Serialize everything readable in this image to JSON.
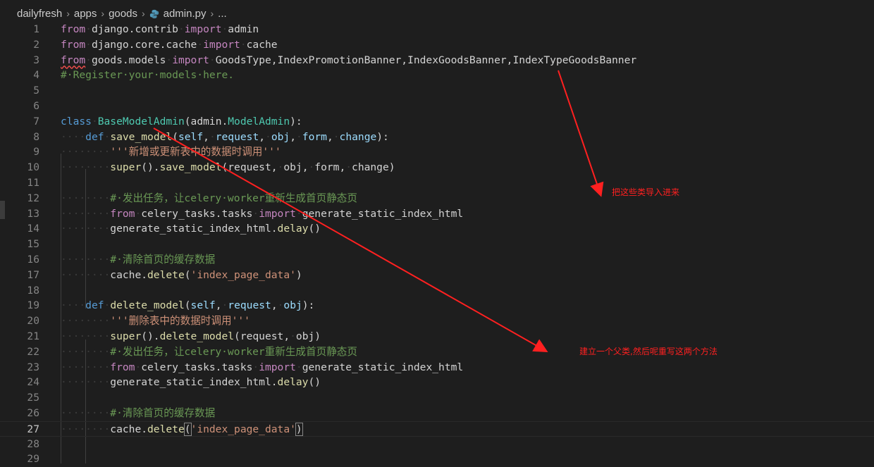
{
  "breadcrumb": {
    "items": [
      "dailyfresh",
      "apps",
      "goods",
      "admin.py",
      "..."
    ]
  },
  "lines": [
    {
      "n": "1",
      "tokens": [
        [
          "kw2",
          "from"
        ],
        [
          "ws",
          "·"
        ],
        [
          "",
          "django.contrib"
        ],
        [
          "ws",
          "·"
        ],
        [
          "kw2",
          "import"
        ],
        [
          "ws",
          "·"
        ],
        [
          "",
          "admin"
        ]
      ]
    },
    {
      "n": "2",
      "tokens": [
        [
          "kw2",
          "from"
        ],
        [
          "ws",
          "·"
        ],
        [
          "",
          "django.core.cache"
        ],
        [
          "ws",
          "·"
        ],
        [
          "kw2",
          "import"
        ],
        [
          "ws",
          "·"
        ],
        [
          "",
          "cache"
        ]
      ]
    },
    {
      "n": "3",
      "tokens": [
        [
          "kw2 squig",
          "from"
        ],
        [
          "ws",
          "·"
        ],
        [
          "",
          "goods.models"
        ],
        [
          "ws",
          "·"
        ],
        [
          "kw2",
          "import"
        ],
        [
          "ws",
          "·"
        ],
        [
          "",
          "GoodsType,IndexPromotionBanner,IndexGoodsBanner,IndexTypeGoodsBanner"
        ]
      ]
    },
    {
      "n": "4",
      "tokens": [
        [
          "cmt",
          "#·Register·your·models·here."
        ]
      ]
    },
    {
      "n": "5",
      "tokens": []
    },
    {
      "n": "6",
      "tokens": []
    },
    {
      "n": "7",
      "tokens": [
        [
          "kw",
          "class"
        ],
        [
          "ws",
          "·"
        ],
        [
          "cls",
          "BaseModelAdmin"
        ],
        [
          "",
          "("
        ],
        [
          "",
          "admin."
        ],
        [
          "cls",
          "ModelAdmin"
        ],
        [
          "",
          "):"
        ]
      ]
    },
    {
      "n": "8",
      "tokens": [
        [
          "ws",
          "····"
        ],
        [
          "kw",
          "def"
        ],
        [
          "ws",
          "·"
        ],
        [
          "fn",
          "save_model"
        ],
        [
          "",
          "("
        ],
        [
          "var",
          "self"
        ],
        [
          "",
          ","
        ],
        [
          "ws",
          "·"
        ],
        [
          "var",
          "request"
        ],
        [
          "",
          ","
        ],
        [
          "ws",
          "·"
        ],
        [
          "var",
          "obj"
        ],
        [
          "",
          ","
        ],
        [
          "ws",
          "·"
        ],
        [
          "var",
          "form"
        ],
        [
          "",
          ","
        ],
        [
          "ws",
          "·"
        ],
        [
          "var",
          "change"
        ],
        [
          "",
          "):"
        ]
      ]
    },
    {
      "n": "9",
      "tokens": [
        [
          "ws",
          "········"
        ],
        [
          "str",
          "'''新增或更新表中的数据时调用'''"
        ]
      ]
    },
    {
      "n": "10",
      "tokens": [
        [
          "ws",
          "········"
        ],
        [
          "fn",
          "super"
        ],
        [
          "",
          "()."
        ],
        [
          "fn",
          "save_model"
        ],
        [
          "",
          "(request,"
        ],
        [
          "ws",
          "·"
        ],
        [
          "",
          "obj,"
        ],
        [
          "ws",
          "·"
        ],
        [
          "",
          "form,"
        ],
        [
          "ws",
          "·"
        ],
        [
          "",
          "change)"
        ]
      ]
    },
    {
      "n": "11",
      "tokens": []
    },
    {
      "n": "12",
      "tokens": [
        [
          "ws",
          "········"
        ],
        [
          "cmt",
          "#·发出任务，让celery·worker重新生成首页静态页"
        ]
      ]
    },
    {
      "n": "13",
      "tokens": [
        [
          "ws",
          "········"
        ],
        [
          "kw2",
          "from"
        ],
        [
          "ws",
          "·"
        ],
        [
          "",
          "celery_tasks.tasks"
        ],
        [
          "ws",
          "·"
        ],
        [
          "kw2",
          "import"
        ],
        [
          "ws",
          "·"
        ],
        [
          "",
          "generate_static_index_html"
        ]
      ]
    },
    {
      "n": "14",
      "tokens": [
        [
          "ws",
          "········"
        ],
        [
          "",
          "generate_static_index_html."
        ],
        [
          "fn",
          "delay"
        ],
        [
          "",
          "()"
        ]
      ]
    },
    {
      "n": "15",
      "tokens": []
    },
    {
      "n": "16",
      "tokens": [
        [
          "ws",
          "········"
        ],
        [
          "cmt",
          "#·清除首页的缓存数据"
        ]
      ]
    },
    {
      "n": "17",
      "tokens": [
        [
          "ws",
          "········"
        ],
        [
          "",
          "cache."
        ],
        [
          "fn",
          "delete"
        ],
        [
          "",
          "("
        ],
        [
          "str",
          "'index_page_data'"
        ],
        [
          "",
          ")"
        ]
      ]
    },
    {
      "n": "18",
      "tokens": []
    },
    {
      "n": "19",
      "tokens": [
        [
          "ws",
          "····"
        ],
        [
          "kw",
          "def"
        ],
        [
          "ws",
          "·"
        ],
        [
          "fn",
          "delete_model"
        ],
        [
          "",
          "("
        ],
        [
          "var",
          "self"
        ],
        [
          "",
          ","
        ],
        [
          "ws",
          "·"
        ],
        [
          "var",
          "request"
        ],
        [
          "",
          ","
        ],
        [
          "ws",
          "·"
        ],
        [
          "var",
          "obj"
        ],
        [
          "",
          "):"
        ]
      ]
    },
    {
      "n": "20",
      "tokens": [
        [
          "ws",
          "········"
        ],
        [
          "str",
          "'''删除表中的数据时调用'''"
        ]
      ]
    },
    {
      "n": "21",
      "tokens": [
        [
          "ws",
          "········"
        ],
        [
          "fn",
          "super"
        ],
        [
          "",
          "()."
        ],
        [
          "fn",
          "delete_model"
        ],
        [
          "",
          "(request,"
        ],
        [
          "ws",
          "·"
        ],
        [
          "",
          "obj)"
        ]
      ]
    },
    {
      "n": "22",
      "tokens": [
        [
          "ws",
          "········"
        ],
        [
          "cmt",
          "#·发出任务，让celery·worker重新生成首页静态页"
        ]
      ]
    },
    {
      "n": "23",
      "tokens": [
        [
          "ws",
          "········"
        ],
        [
          "kw2",
          "from"
        ],
        [
          "ws",
          "·"
        ],
        [
          "",
          "celery_tasks.tasks"
        ],
        [
          "ws",
          "·"
        ],
        [
          "kw2",
          "import"
        ],
        [
          "ws",
          "·"
        ],
        [
          "",
          "generate_static_index_html"
        ]
      ]
    },
    {
      "n": "24",
      "tokens": [
        [
          "ws",
          "········"
        ],
        [
          "",
          "generate_static_index_html."
        ],
        [
          "fn",
          "delay"
        ],
        [
          "",
          "()"
        ]
      ]
    },
    {
      "n": "25",
      "tokens": []
    },
    {
      "n": "26",
      "tokens": [
        [
          "ws",
          "········"
        ],
        [
          "cmt",
          "#·清除首页的缓存数据"
        ]
      ]
    },
    {
      "n": "27",
      "tokens": [
        [
          "ws",
          "········"
        ],
        [
          "",
          "cache."
        ],
        [
          "fn",
          "delete"
        ],
        [
          "bracket-hl",
          "("
        ],
        [
          "str",
          "'index_page_data'"
        ],
        [
          "bracket-hl",
          ")"
        ]
      ]
    },
    {
      "n": "28",
      "tokens": []
    },
    {
      "n": "29",
      "tokens": []
    }
  ],
  "current_line": "27",
  "annotations": {
    "import_note": "把这些类导入进来",
    "class_note": "建立一个父类,然后呢重写这两个方法"
  },
  "colors": {
    "annotation": "#ff2020",
    "background": "#1e1e1e"
  }
}
